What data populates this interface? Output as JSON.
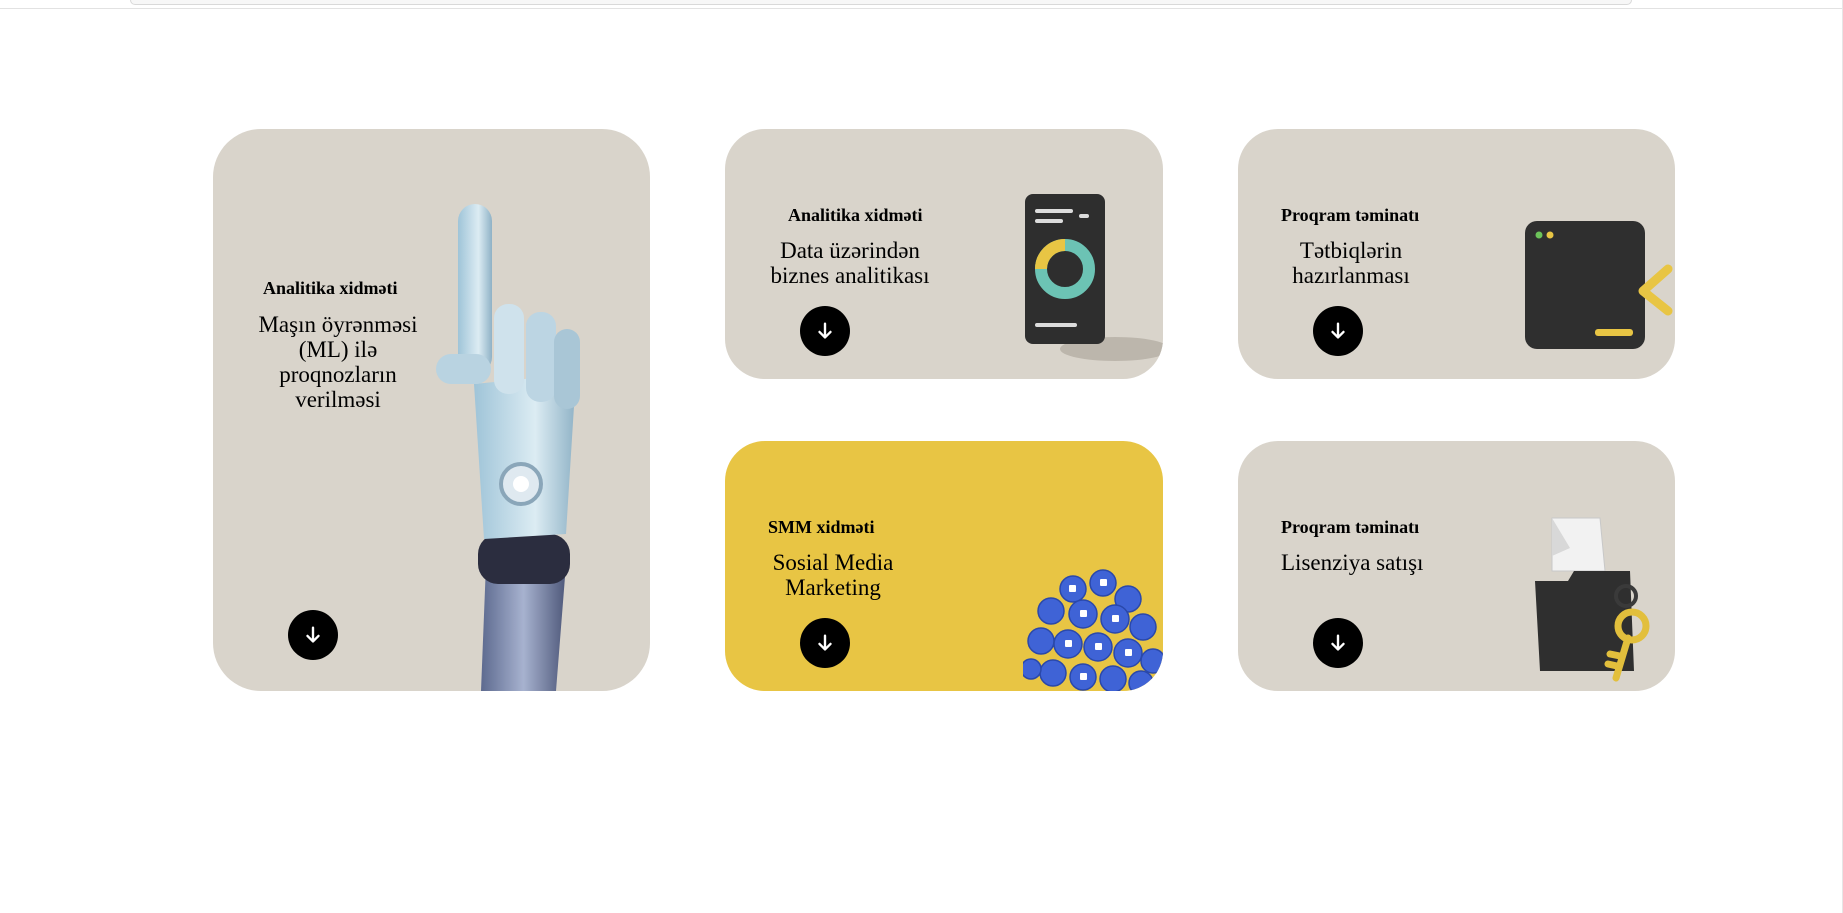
{
  "cards": [
    {
      "kicker": "Analitika xidməti",
      "title": "Maşın öyrənməsi (ML) ilə proqnozların verilməsi",
      "image": "robot-hand-icon"
    },
    {
      "kicker": "Analitika xidməti",
      "title": "Data üzərindən biznes analitikası",
      "image": "donut-chart-tablet-icon"
    },
    {
      "kicker": "Proqram təminatı",
      "title": "Tətbiqlərin hazırlanması",
      "image": "code-terminal-icon"
    },
    {
      "kicker": "SMM xidməti",
      "title": "Sosial Media Marketing",
      "image": "like-bubbles-icon"
    },
    {
      "kicker": "Proqram təminatı",
      "title": "Lisenziya satışı",
      "image": "folder-key-icon"
    }
  ],
  "arrow_icon": "arrow-down-icon",
  "colors": {
    "card_bg": "#d9d4cb",
    "accent_yellow": "#e8c544",
    "button_bg": "#000000"
  }
}
